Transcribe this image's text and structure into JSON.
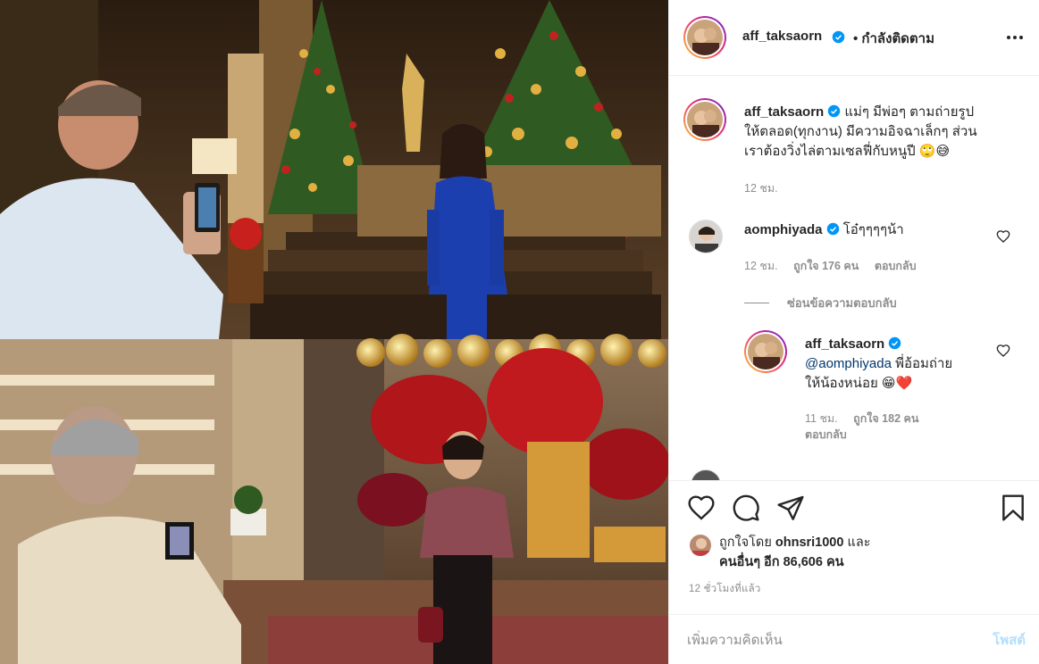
{
  "post": {
    "author": "aff_taksaorn",
    "follow_status": "• กำลังติดตาม",
    "caption_lines": [
      "แม่ๆ มีพ่อๆ ตามถ่ายรูป",
      "ให้ตลอด(ทุกงาน) มีความอิจฉาเล็กๆ ส่วน",
      "เราต้องวิ่งไล่ตามเซลฟี่กับหนูปี 🙄😅"
    ],
    "caption_time": "12 ชม.",
    "likes_prefix": "ถูกใจโดย",
    "likes_user": "ohnsri1000",
    "likes_and": "และ",
    "likes_others_label": "คนอื่นๆ อีก",
    "likes_count": "86,606",
    "likes_unit": "คน",
    "timestamp": "12 ชั่วโมงที่แล้ว"
  },
  "comments": [
    {
      "user": "aomphiyada",
      "text": "โอ๋ๆๆๆๆน้า",
      "time": "12 ชม.",
      "likes": "ถูกใจ 176 คน",
      "reply_label": "ตอบกลับ"
    }
  ],
  "hide_replies": "ซ่อนข้อความตอบกลับ",
  "reply": {
    "user": "aff_taksaorn",
    "mention": "@aomphiyada",
    "text_line1": "พี่อ้อมถ่าย",
    "text_line2": "ให้น้องหน่อย 😁❤️",
    "time": "11 ชม.",
    "likes": "ถูกใจ 182 คน",
    "reply_label": "ตอบกลับ"
  },
  "add_comment": {
    "placeholder": "เพิ่มความคิดเห็น",
    "post_label": "โพสต์"
  },
  "icons": [
    "more-icon",
    "heart-icon",
    "comment-icon",
    "share-icon",
    "bookmark-icon",
    "verified-icon"
  ],
  "colors": {
    "verified": "#0095f6",
    "post_button_disabled": "#b2dffc",
    "text_secondary": "#8e8e8e",
    "mention": "#00376b"
  }
}
